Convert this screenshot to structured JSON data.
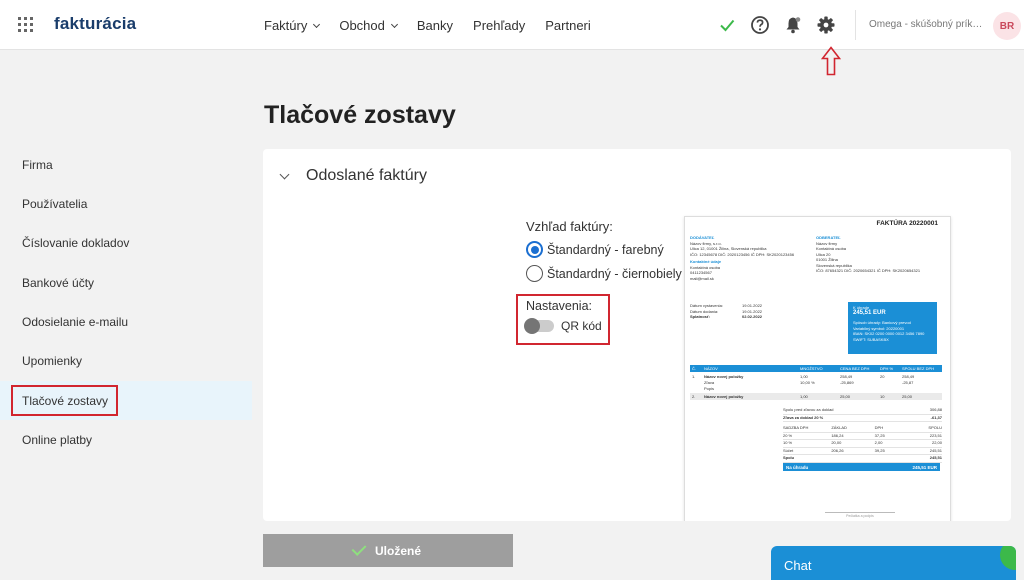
{
  "app": {
    "logo": "fakturácia",
    "company": "Omega - skúšobný príklad",
    "avatar_initials": "BR"
  },
  "nav": [
    {
      "label": "Faktúry",
      "dropdown": true
    },
    {
      "label": "Obchod",
      "dropdown": true
    },
    {
      "label": "Banky",
      "dropdown": false
    },
    {
      "label": "Prehľady",
      "dropdown": false
    },
    {
      "label": "Partneri",
      "dropdown": false
    }
  ],
  "icons": {
    "status": "check-icon",
    "help": "help-icon",
    "notifications": "bell-icon",
    "settings": "gear-icon"
  },
  "colors": {
    "accent": "#1b8fd6",
    "highlight": "#d12630",
    "active_item_bg": "#e8f4fb",
    "check": "#3cb94a"
  },
  "page": {
    "title": "Tlačové zostavy"
  },
  "sidebar": {
    "items": [
      {
        "label": "Firma"
      },
      {
        "label": "Používatelia"
      },
      {
        "label": "Číslovanie dokladov"
      },
      {
        "label": "Bankové účty"
      },
      {
        "label": "Odosielanie e-mailu"
      },
      {
        "label": "Upomienky"
      },
      {
        "label": "Tlačové zostavy",
        "active": true
      },
      {
        "label": "Online platby"
      }
    ]
  },
  "section": {
    "title": "Odoslané faktúry",
    "appearance_label": "Vzhľad faktúry:",
    "options": [
      {
        "label": "Štandardný - farebný",
        "selected": true
      },
      {
        "label": "Štandardný - čiernobiely",
        "selected": false
      }
    ],
    "settings_label": "Nastavenia:",
    "qr_label": "QR kód",
    "qr_enabled": false
  },
  "preview": {
    "title": "FAKTÚRA 20220001",
    "supplier_label": "DODÁVATEĽ",
    "supplier_lines": [
      "Názov firmy, s.r.o.",
      "Ulica 12, 01001 Žilina, Slovenská republika",
      "IČO: 12345678   DIČ: 2020123456   IČ DPH: SK2020123456"
    ],
    "contact_label": "Kontaktné údaje",
    "contact_lines": [
      "Kontaktná osoba",
      "0411234567",
      "mail@mail.sk"
    ],
    "customer_label": "ODBERATEĽ",
    "customer_lines": [
      "Názov firmy",
      "Kontaktná osoba",
      "Ulica 20",
      "01001 Žilina",
      "Slovenská republika",
      "IČO: 87654321   DIČ: 2020654321   IČ DPH: SK2020654321"
    ],
    "dates": [
      {
        "k": "Dátum vystavenia:",
        "v": "19.01.2022"
      },
      {
        "k": "Dátum dodania:",
        "v": "19.01.2022"
      },
      {
        "k": "Splatnosť:",
        "v": "02.02.2022"
      }
    ],
    "pay_box": {
      "label": "K úhrade",
      "amount": "245,51 EUR",
      "lines": [
        "Spôsob úhrady: Bankový prevod",
        "Variabilný symbol: 20220001",
        "IBAN: SK02 0200 0000 0012 3456 7890",
        "SWIFT: SUBASKBX"
      ]
    },
    "table_header": [
      "Č.",
      "NÁZOV",
      "MNOŽSTVO",
      "CENA BEZ DPH",
      "DPH %",
      "SPOLU BEZ DPH"
    ],
    "rows": [
      {
        "c": "1.",
        "name": "Názov novej položky",
        "qty": "1,00",
        "price": "258,49",
        "vat": "20",
        "total": "258,49"
      },
      {
        "c": "",
        "name": "Zľava",
        "qty": "10,00 %",
        "price": "-25,869",
        "vat": "",
        "total": "-25,87"
      },
      {
        "c": "",
        "name": "Popis",
        "qty": "",
        "price": "",
        "vat": "",
        "total": ""
      },
      {
        "c": "2.",
        "name": "Názov novej položky",
        "qty": "1,00",
        "price": "25,00",
        "vat": "10",
        "total": "25,00"
      }
    ],
    "summary_top": [
      {
        "k": "Spolu pred zľavou za doklad",
        "v": "306,88"
      },
      {
        "k": "Zľava za doklad 20 %",
        "v": "-61,37"
      }
    ],
    "vat_header": [
      "SADZBA DPH",
      "ZÁKLAD",
      "DPH",
      "SPOLU"
    ],
    "vat_rows": [
      [
        "20 %",
        "186,24",
        "37,25",
        "223,51"
      ],
      [
        "10 %",
        "20,00",
        "2,00",
        "22,00"
      ],
      [
        "Súčet",
        "206,26",
        "39,25",
        "245,51"
      ],
      [
        "Spolu",
        "",
        "",
        "245,51"
      ]
    ],
    "total_label": "Na úhradu",
    "total_value": "245,51 EUR",
    "signature": "Pečiatka a podpis"
  },
  "actions": {
    "save_label": "Uložené"
  },
  "chat": {
    "label": "Chat"
  }
}
